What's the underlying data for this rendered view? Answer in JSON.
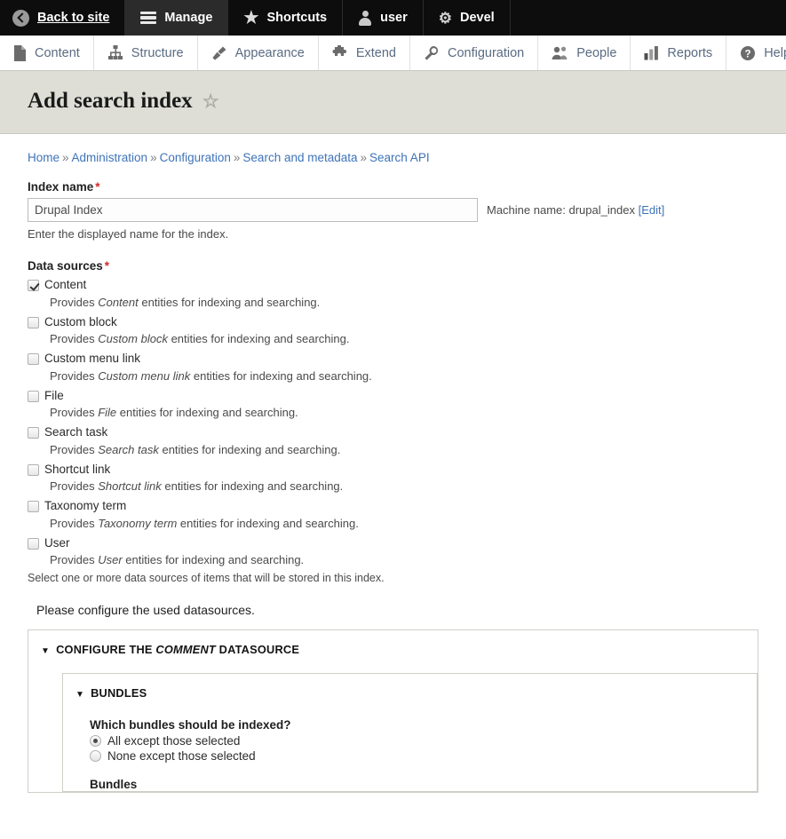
{
  "toolbar": {
    "items": [
      {
        "label": "Back to site",
        "icon": "back-arrow-icon",
        "active": false
      },
      {
        "label": "Manage",
        "icon": "hamburger-icon",
        "active": true
      },
      {
        "label": "Shortcuts",
        "icon": "star-icon",
        "active": false
      },
      {
        "label": "user",
        "icon": "person-icon",
        "active": false
      },
      {
        "label": "Devel",
        "icon": "gear-icon",
        "active": false
      }
    ]
  },
  "admin_menu": {
    "items": [
      {
        "label": "Content",
        "icon": "file-icon"
      },
      {
        "label": "Structure",
        "icon": "sitemap-icon"
      },
      {
        "label": "Appearance",
        "icon": "paintbrush-icon"
      },
      {
        "label": "Extend",
        "icon": "puzzle-icon"
      },
      {
        "label": "Configuration",
        "icon": "wrench-icon"
      },
      {
        "label": "People",
        "icon": "people-icon"
      },
      {
        "label": "Reports",
        "icon": "bar-chart-icon"
      },
      {
        "label": "Help",
        "icon": "question-circle-icon"
      }
    ]
  },
  "page": {
    "title": "Add search index",
    "star_icon": "star-outline-icon"
  },
  "breadcrumb": {
    "separator": "»",
    "items": [
      "Home",
      "Administration",
      "Configuration",
      "Search and metadata",
      "Search API"
    ]
  },
  "index_name": {
    "label": "Index name",
    "required_marker": "*",
    "value": "Drupal Index",
    "placeholder": "",
    "machine_name_prefix": "Machine name: ",
    "machine_name_value": "drupal_index",
    "machine_name_edit": "[Edit]",
    "description": "Enter the displayed name for the index."
  },
  "data_sources": {
    "label": "Data sources",
    "required_marker": "*",
    "options": [
      {
        "label": "Content",
        "checked": true,
        "desc_prefix": "Provides ",
        "desc_em": "Content",
        "desc_suffix": " entities for indexing and searching."
      },
      {
        "label": "Custom block",
        "checked": false,
        "desc_prefix": "Provides ",
        "desc_em": "Custom block",
        "desc_suffix": " entities for indexing and searching."
      },
      {
        "label": "Custom menu link",
        "checked": false,
        "desc_prefix": "Provides ",
        "desc_em": "Custom menu link",
        "desc_suffix": " entities for indexing and searching."
      },
      {
        "label": "File",
        "checked": false,
        "desc_prefix": "Provides ",
        "desc_em": "File",
        "desc_suffix": " entities for indexing and searching."
      },
      {
        "label": "Search task",
        "checked": false,
        "desc_prefix": "Provides ",
        "desc_em": "Search task",
        "desc_suffix": " entities for indexing and searching."
      },
      {
        "label": "Shortcut link",
        "checked": false,
        "desc_prefix": "Provides ",
        "desc_em": "Shortcut link",
        "desc_suffix": " entities for indexing and searching."
      },
      {
        "label": "Taxonomy term",
        "checked": false,
        "desc_prefix": "Provides ",
        "desc_em": "Taxonomy term",
        "desc_suffix": " entities for indexing and searching."
      },
      {
        "label": "User",
        "checked": false,
        "desc_prefix": "Provides ",
        "desc_em": "User",
        "desc_suffix": " entities for indexing and searching."
      }
    ],
    "help": "Select one or more data sources of items that will be stored in this index."
  },
  "configure_message": "Please configure the used datasources.",
  "datasource_fieldset": {
    "triangle": "▼",
    "legend_prefix": "CONFIGURE THE ",
    "legend_em": "COMMENT",
    "legend_suffix": " DATASOURCE"
  },
  "bundles_fieldset": {
    "triangle": "▼",
    "legend": "BUNDLES",
    "question": "Which bundles should be indexed?",
    "radios": [
      {
        "label": "All except those selected",
        "selected": true
      },
      {
        "label": "None except those selected",
        "selected": false
      }
    ],
    "bundles_label": "Bundles"
  },
  "colors": {
    "toolbar_bg": "#0d0d0d",
    "toolbar_active_bg": "#2b2b2b",
    "title_bar_bg": "#deded7",
    "link": "#3e73b9",
    "required": "#d42727"
  }
}
